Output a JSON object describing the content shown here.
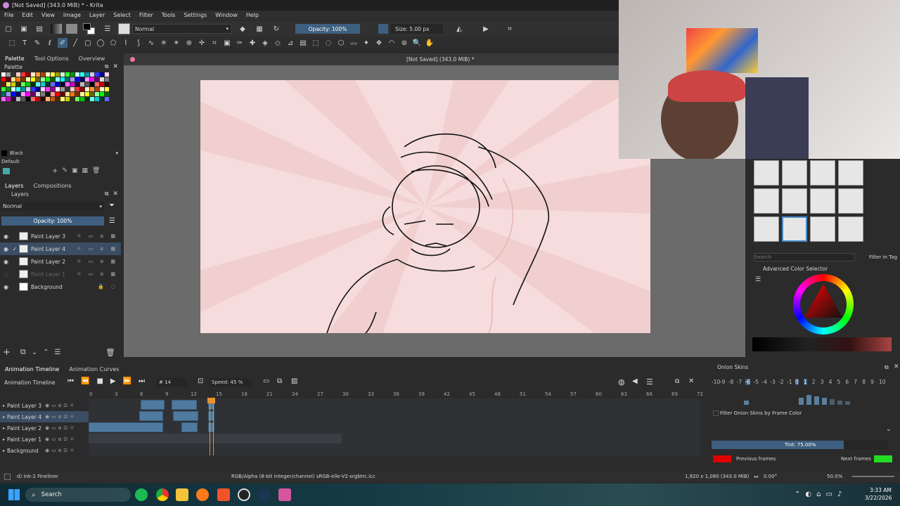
{
  "window": {
    "title": "[Not Saved]  (343.0 MiB) * - Krita"
  },
  "menu": [
    "File",
    "Edit",
    "View",
    "Image",
    "Layer",
    "Select",
    "Filter",
    "Tools",
    "Settings",
    "Window",
    "Help"
  ],
  "toolbar": {
    "blend_mode": "Normal",
    "opacity": "Opacity: 100%",
    "size": "Size: 5.00 px"
  },
  "dockers_left_tabs": [
    "Palette",
    "Tool Options",
    "Overview"
  ],
  "palette": {
    "title": "Palette",
    "current_color": "Black",
    "set_name": "Default"
  },
  "layers_tabs": [
    "Layers",
    "Compositions"
  ],
  "layers": {
    "title": "Layers",
    "blend_mode": "Normal",
    "opacity": "Opacity:  100%",
    "items": [
      {
        "name": "Paint Layer 3",
        "visible": true,
        "selected": false
      },
      {
        "name": "Paint Layer 4",
        "visible": true,
        "selected": true
      },
      {
        "name": "Paint Layer 2",
        "visible": true,
        "selected": false
      },
      {
        "name": "Paint Layer 1",
        "visible": false,
        "selected": false
      },
      {
        "name": "Background",
        "visible": true,
        "selected": false
      }
    ]
  },
  "canvas": {
    "title": "[Not Saved]  (343.0 MiB) *"
  },
  "animation": {
    "tabs": [
      "Animation Timeline",
      "Animation Curves"
    ],
    "title": "Animation Timeline",
    "frame": "# 14",
    "speed": "Speed: 45 %",
    "ticks": [
      "0",
      "3",
      "6",
      "9",
      "12",
      "15",
      "18",
      "21",
      "24",
      "27",
      "30",
      "33",
      "36",
      "39",
      "42",
      "45",
      "48",
      "51",
      "54",
      "57",
      "60",
      "63",
      "66",
      "69",
      "72"
    ],
    "layers": [
      "Paint Layer 3",
      "Paint Layer 4",
      "Paint Layer 2",
      "Paint Layer 1",
      "Background"
    ]
  },
  "onion": {
    "title": "Onion Skins",
    "numbers": [
      "-10",
      "-9",
      "-8",
      "-7",
      "-6",
      "-5",
      "-4",
      "-3",
      "-2",
      "-1",
      "0",
      "1",
      "2",
      "3",
      "4",
      "5",
      "6",
      "7",
      "8",
      "9",
      "10"
    ],
    "filter_label": "Filter Onion Skins by Frame Color",
    "tint": "Tint: 75.00%",
    "previous": "Previous frames",
    "next": "Next frames",
    "prev_color": "#e00000",
    "next_color": "#22dd22"
  },
  "brushes": {
    "search_placeholder": "Search",
    "filter_label": "Filter in Tag"
  },
  "color_selector": {
    "title": "Advanced Color Selector"
  },
  "status": {
    "brush": "d) Ink-2 Fineliner",
    "colorspace": "RGB/Alpha (8-bit integer/channel)  sRGB-elle-V2-srgbtrc.icc",
    "dims": "1,920 x 1,080 (343.0 MiB)",
    "rotation": "0.00°",
    "zoom": "50.0%"
  },
  "taskbar": {
    "search": "Search",
    "time": "3:33 AM",
    "date": "3/22/2026"
  }
}
